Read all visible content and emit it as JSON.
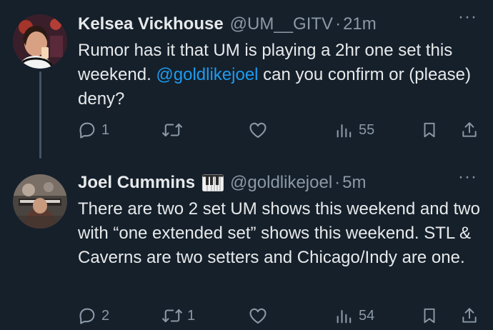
{
  "tweets": [
    {
      "name": "Kelsea Vickhouse",
      "handle": "@UM__GITV",
      "separator": "·",
      "time": "21m",
      "more": "···",
      "text_before": "Rumor has it that UM is playing a 2hr one set this weekend. ",
      "mention": "@goldlikejoel",
      "text_after": " can you confirm or (please) deny?",
      "counts": {
        "replies": "1",
        "reposts": "",
        "likes": "",
        "views": "55"
      }
    },
    {
      "name": "Joel Cummins",
      "badge": "piano-keys-emoji",
      "handle": "@goldlikejoel",
      "separator": "·",
      "time": "5m",
      "more": "···",
      "text": "There are two 2 set UM shows this weekend and two with “one extended set” shows this weekend. STL & Caverns are two setters and Chicago/Indy are one.",
      "counts": {
        "replies": "2",
        "reposts": "1",
        "likes": "",
        "views": "54"
      }
    }
  ],
  "colors": {
    "background": "#15202b",
    "primary_text": "#e7e9ea",
    "secondary_text": "#8b98a5",
    "link": "#1d9bf0",
    "thread_line": "#425364"
  },
  "icons": [
    "reply-icon",
    "repost-icon",
    "like-icon",
    "views-icon",
    "bookmark-icon",
    "share-icon",
    "more-icon"
  ]
}
